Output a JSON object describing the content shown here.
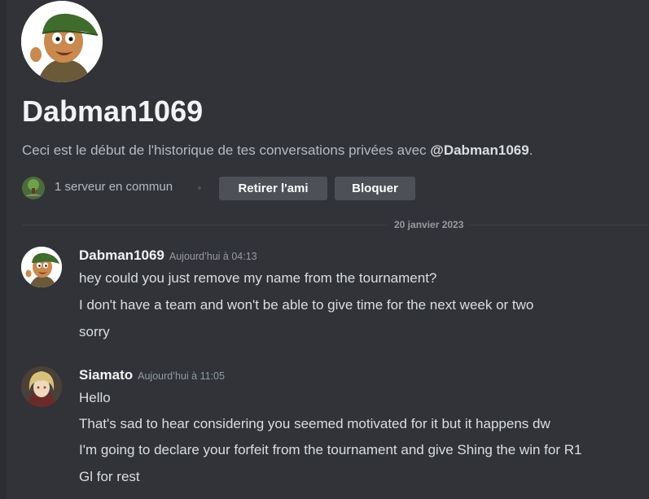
{
  "profile": {
    "username": "Dabman1069",
    "intro_prefix": "Ceci est le début de l'historique de tes conversations privées avec ",
    "intro_mention": "@Dabman1069",
    "intro_suffix": ".",
    "mutual_servers": "1 serveur en commun",
    "unfriend_label": "Retirer l'ami",
    "block_label": "Bloquer"
  },
  "divider": {
    "date": "20 janvier 2023"
  },
  "messages": [
    {
      "author": "Dabman1069",
      "timestamp": "Aujourd’hui à 04:13",
      "lines": [
        "hey could you just remove my name from the tournament?",
        "I don't have a team and won't be able to give time for the next week or two",
        "sorry"
      ]
    },
    {
      "author": "Siamato",
      "timestamp": "Aujourd’hui à 11:05",
      "lines": [
        "Hello",
        "That's sad to hear considering you seemed motivated for it but it happens dw",
        "I'm going to declare your forfeit from the tournament and give Shing the win for R1",
        "Gl for rest"
      ]
    }
  ],
  "icons": {
    "profile_avatar": "cartoon-boy-avatar-icon",
    "server_icon": "server-icon",
    "second_avatar": "anime-character-avatar-icon"
  },
  "colors": {
    "background": "#313338",
    "button": "#4e5058",
    "muted_text": "#b5bac1",
    "timestamp": "#949ba4"
  }
}
